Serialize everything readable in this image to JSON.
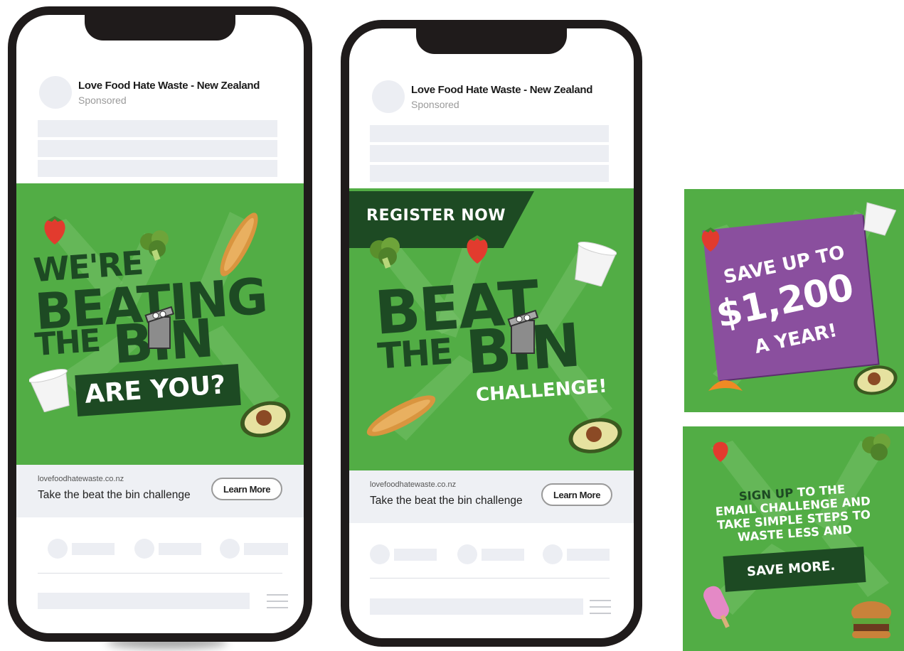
{
  "post": {
    "page_name": "Love Food Hate Waste - New Zealand",
    "sponsored": "Sponsored",
    "url": "lovefoodhatewaste.co.nz",
    "cta_text": "Take the beat the bin challenge",
    "button_label": "Learn More"
  },
  "ad1": {
    "line1": "WE'RE",
    "line2": "BEATING",
    "line3": "THE",
    "line4": "BIN",
    "tagline": "ARE YOU?"
  },
  "ad2": {
    "banner": "REGISTER NOW",
    "line1": "BEAT",
    "line2": "THE",
    "line3": "BIN",
    "subline": "CHALLENGE!"
  },
  "square1": {
    "line1": "SAVE UP TO",
    "line2": "$1,200",
    "line3": "A YEAR!"
  },
  "square2": {
    "highlight": "SIGN UP",
    "line1_rest": " TO THE",
    "line2": "EMAIL CHALLENGE AND",
    "line3": "TAKE SIMPLE STEPS TO",
    "line4": "WASTE LESS AND",
    "banner": "SAVE MORE."
  },
  "colors": {
    "brand_green": "#52ad45",
    "dark_green": "#1d4a23",
    "purple": "#8a4f9e",
    "light_green_text": "#6fd35a"
  }
}
